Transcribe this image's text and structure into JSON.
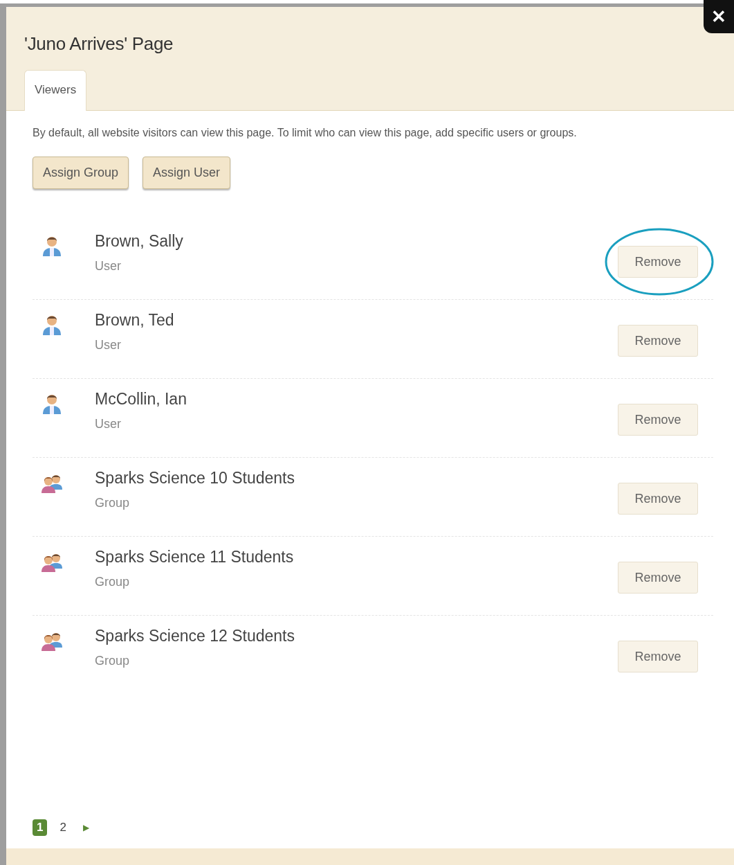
{
  "dialog": {
    "title": "'Juno Arrives' Page",
    "close": "✕"
  },
  "tabs": [
    {
      "label": "Viewers",
      "selected": true
    }
  ],
  "description": "By default, all website visitors can view this page. To limit who can view this page, add specific users or groups.",
  "actions": [
    "Assign Group",
    "Assign User"
  ],
  "viewers": [
    {
      "name": "Brown, Sally",
      "type": "User",
      "kind": "user",
      "action": "Remove",
      "highlighted": true
    },
    {
      "name": "Brown, Ted",
      "type": "User",
      "kind": "user",
      "action": "Remove",
      "highlighted": false
    },
    {
      "name": "McCollin, Ian",
      "type": "User",
      "kind": "user",
      "action": "Remove",
      "highlighted": false
    },
    {
      "name": "Sparks Science 10 Students",
      "type": "Group",
      "kind": "group",
      "action": "Remove",
      "highlighted": false
    },
    {
      "name": "Sparks Science 11 Students",
      "type": "Group",
      "kind": "group",
      "action": "Remove",
      "highlighted": false
    },
    {
      "name": "Sparks Science 12 Students",
      "type": "Group",
      "kind": "group",
      "action": "Remove",
      "highlighted": false
    }
  ],
  "pagination": {
    "pages": [
      {
        "label": "1",
        "selected": true
      },
      {
        "label": "2",
        "selected": false
      }
    ],
    "next": "▶"
  }
}
